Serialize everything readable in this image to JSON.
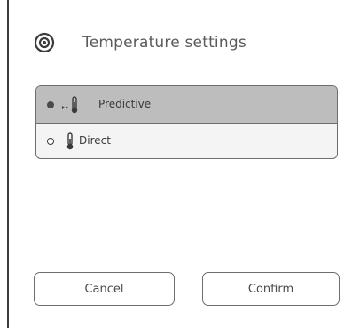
{
  "header": {
    "icon": "target-icon",
    "title": "Temperature settings"
  },
  "options": [
    {
      "label": "Predictive",
      "icon": "fast-thermometer-icon",
      "selected": true
    },
    {
      "label": "Direct",
      "icon": "thermometer-icon",
      "selected": false
    }
  ],
  "buttons": {
    "cancel_label": "Cancel",
    "confirm_label": "Confirm"
  },
  "colors": {
    "selected_row": "#bdbdbd",
    "border": "#6e6e6e",
    "text": "#3a3a3a"
  }
}
